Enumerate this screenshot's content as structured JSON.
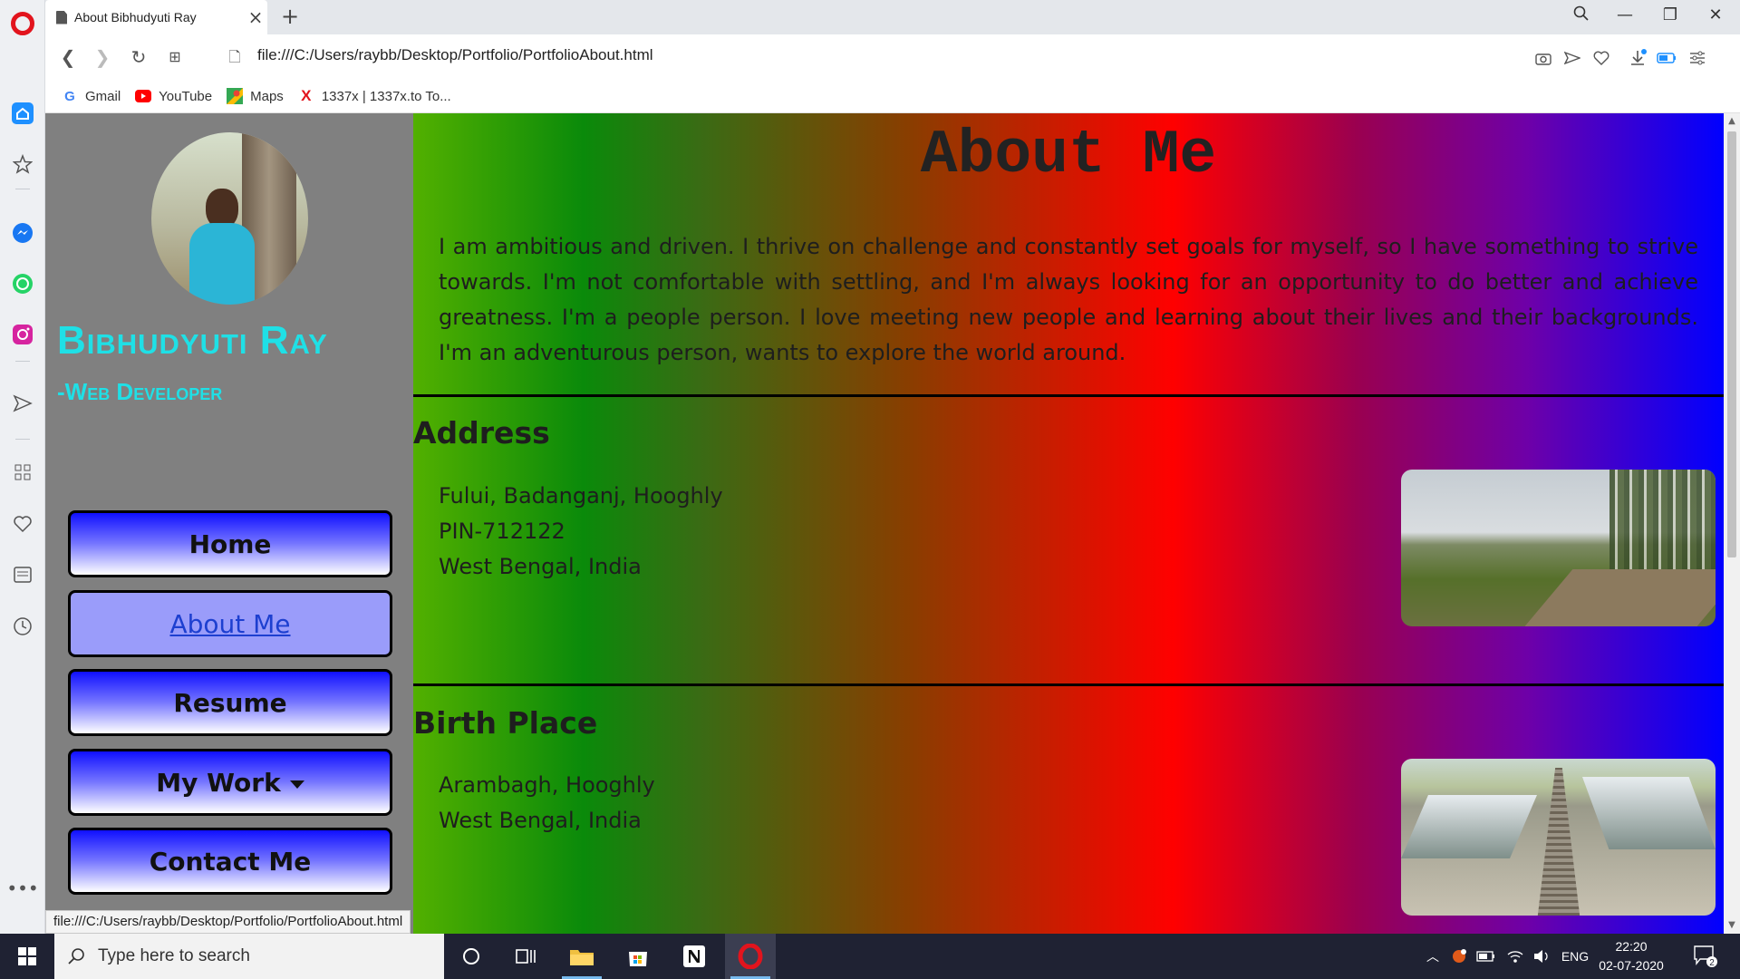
{
  "browser": {
    "tab_title": "About Bibhudyuti Ray",
    "url": "file:///C:/Users/raybb/Desktop/Portfolio/PortfolioAbout.html",
    "status_url": "file:///C:/Users/raybb/Desktop/Portfolio/PortfolioAbout.html",
    "bookmarks": [
      {
        "label": "Gmail",
        "icon": "google-icon"
      },
      {
        "label": "YouTube",
        "icon": "youtube-icon"
      },
      {
        "label": "Maps",
        "icon": "maps-icon"
      },
      {
        "label": "1337x | 1337x.to To...",
        "icon": "1337x-icon"
      }
    ],
    "accent": "#e2141d"
  },
  "sidebar": {
    "name": "Bibhudyuti Ray",
    "role": "-Web Developer",
    "name_color": "#1fe0e6",
    "menu": [
      {
        "label": "Home",
        "active": false
      },
      {
        "label": "About Me",
        "active": true
      },
      {
        "label": "Resume",
        "active": false
      },
      {
        "label": "My Work",
        "active": false,
        "dropdown": true
      },
      {
        "label": "Contact Me",
        "active": false
      }
    ]
  },
  "main": {
    "title": "About Me",
    "about": "I am ambitious and driven. I thrive on challenge and constantly set goals for myself, so I have something to strive towards. I'm not comfortable with settling, and I'm always looking for an opportunity to do better and achieve greatness. I'm a people person. I love meeting new people and learning about their lives and their backgrounds. I'm an adventurous person, wants to explore the world around.",
    "address": {
      "heading": "Address",
      "lines": [
        "Fului, Badanganj, Hooghly",
        "PIN-712122",
        "West Bengal, India"
      ]
    },
    "birth_place": {
      "heading": "Birth Place",
      "lines": [
        "Arambagh, Hooghly",
        "West Bengal, India"
      ]
    }
  },
  "taskbar": {
    "search_placeholder": "Type here to search",
    "language": "ENG",
    "time": "22:20",
    "date": "02-07-2020",
    "notification_count": "2"
  }
}
